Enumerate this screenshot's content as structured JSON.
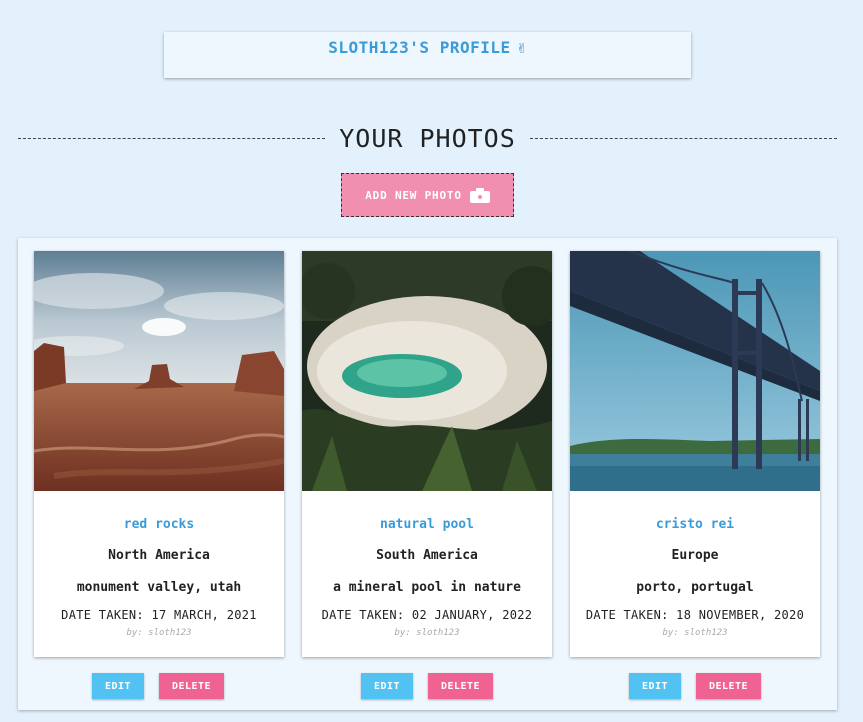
{
  "profile": {
    "title": "SLOTH123'S PROFILE",
    "icon": "victory-hand-icon",
    "icon_glyph": "✌"
  },
  "section": {
    "heading": "YOUR PHOTOS"
  },
  "add_button": {
    "label": "ADD NEW PHOTO",
    "icon": "camera-icon"
  },
  "colors": {
    "page_bg": "#e3f1fd",
    "accent_blue": "#3a9bd8",
    "add_button_pink": "#f08fb0",
    "edit_blue": "#52c2f2",
    "delete_pink": "#ef6291"
  },
  "cards": [
    {
      "title": "red rocks",
      "region": "North America",
      "location": "monument valley, utah",
      "date": "DATE TAKEN: 17 MARCH, 2021",
      "by": "by: sloth123",
      "edit_label": "EDIT",
      "delete_label": "DELETE"
    },
    {
      "title": "natural pool",
      "region": "South America",
      "location": "a mineral pool in nature",
      "date": "DATE TAKEN: 02 JANUARY, 2022",
      "by": "by: sloth123",
      "edit_label": "EDIT",
      "delete_label": "DELETE"
    },
    {
      "title": "cristo rei",
      "region": "Europe",
      "location": "porto, portugal",
      "date": "DATE TAKEN: 18 NOVEMBER, 2020",
      "by": "by: sloth123",
      "edit_label": "EDIT",
      "delete_label": "DELETE"
    }
  ]
}
